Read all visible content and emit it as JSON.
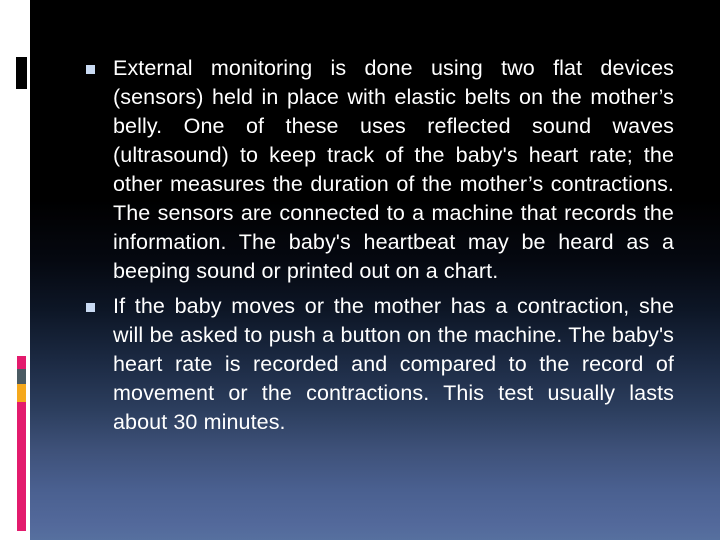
{
  "slide": {
    "background": {
      "type": "vertical-gradient",
      "top_color": "#000000",
      "bottom_color": "#56709f"
    },
    "left_accent": {
      "white_band_color": "#ffffff",
      "black_block_color": "#000000",
      "bars": [
        {
          "name": "magenta-top",
          "color": "#e31b6d"
        },
        {
          "name": "slate",
          "color": "#4b5b63"
        },
        {
          "name": "amber",
          "color": "#f5a81c"
        },
        {
          "name": "magenta-long",
          "color": "#e31b6d"
        }
      ]
    },
    "bullet_marker_color": "#c9daf2",
    "text_color": "#ffffff",
    "bullets": [
      {
        "marker": "square-bullet",
        "text": "External monitoring is done using two flat devices (sensors) held in place with elastic belts on the mother’s belly. One of these uses reflected sound waves (ultrasound) to keep track of the baby's heart rate; the other measures the duration of the mother’s contractions. The sensors are connected to a machine that records the information. The baby's heartbeat may be heard as a beeping sound or printed out on a chart."
      },
      {
        "marker": "square-bullet",
        "text": "If the baby moves or the mother has a contraction, she will be asked to push a button on the machine. The baby's heart rate is recorded and compared to the record of movement or the  contractions. This test usually lasts about 30 minutes."
      }
    ]
  }
}
